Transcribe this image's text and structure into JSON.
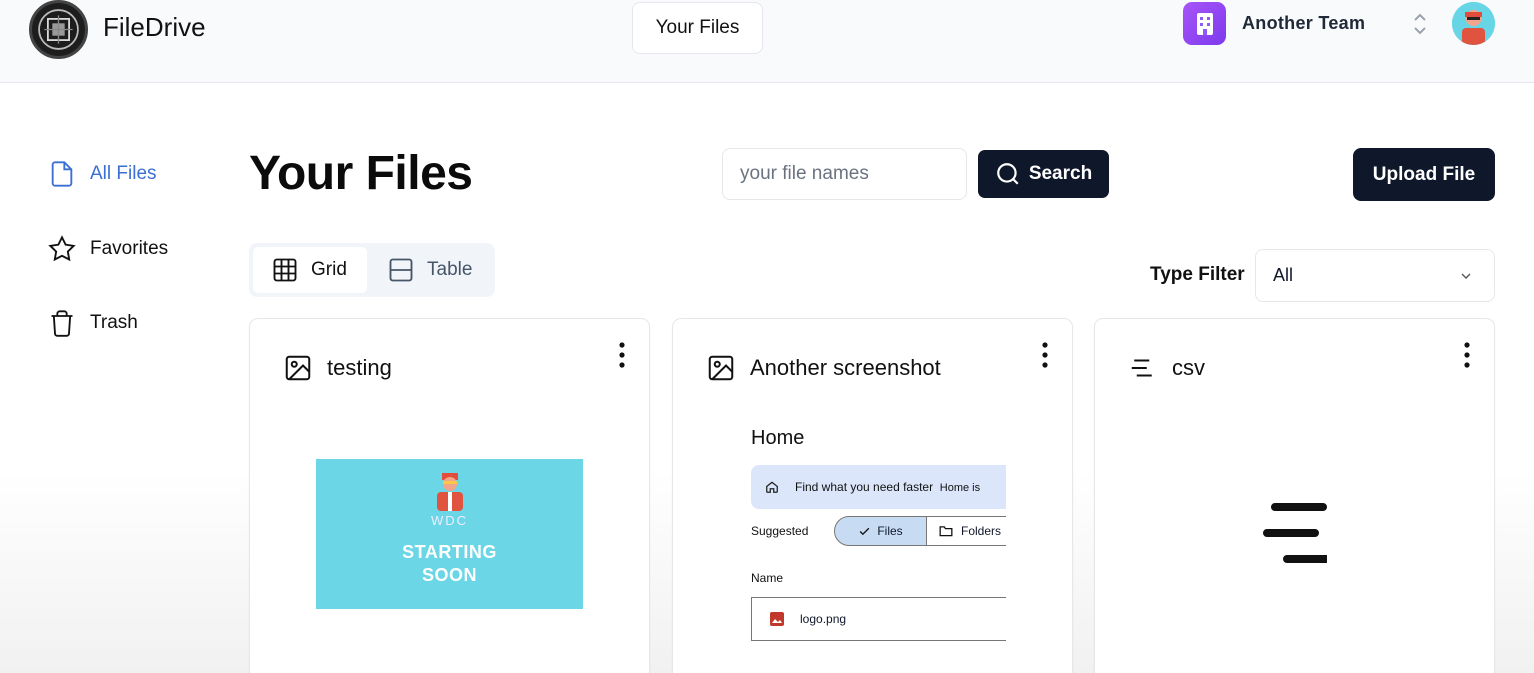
{
  "header": {
    "brand": "FileDrive",
    "nav_tab": "Your Files",
    "team_name": "Another Team"
  },
  "sidebar": {
    "items": [
      {
        "label": "All Files",
        "icon": "file-icon",
        "active": true
      },
      {
        "label": "Favorites",
        "icon": "star-icon",
        "active": false
      },
      {
        "label": "Trash",
        "icon": "trash-icon",
        "active": false
      }
    ]
  },
  "main": {
    "title": "Your Files",
    "search": {
      "placeholder": "your file names",
      "button_label": "Search"
    },
    "upload_label": "Upload File",
    "view_toggle": {
      "grid_label": "Grid",
      "table_label": "Table",
      "selected": "Grid"
    },
    "type_filter": {
      "label": "Type Filter",
      "value": "All"
    }
  },
  "files": [
    {
      "name": "testing",
      "type_icon": "image-icon",
      "thumbnail": {
        "logo_text": "WDC",
        "line1": "STARTING",
        "line2": "SOON"
      }
    },
    {
      "name": "Another screenshot",
      "type_icon": "image-icon",
      "thumbnail": {
        "heading": "Home",
        "banner_text": "Find what you need faster",
        "banner_trailing": "Home is",
        "suggested_label": "Suggested",
        "chip_files": "Files",
        "chip_folders": "Folders",
        "name_header": "Name",
        "row_file": "logo.png"
      }
    },
    {
      "name": "csv",
      "type_icon": "text-lines-icon"
    }
  ],
  "colors": {
    "primary_dark": "#0f172a",
    "active_link": "#3b6fd4",
    "team_accent": "#8b5cf6",
    "thumb_cyan": "#6ad6e6"
  }
}
